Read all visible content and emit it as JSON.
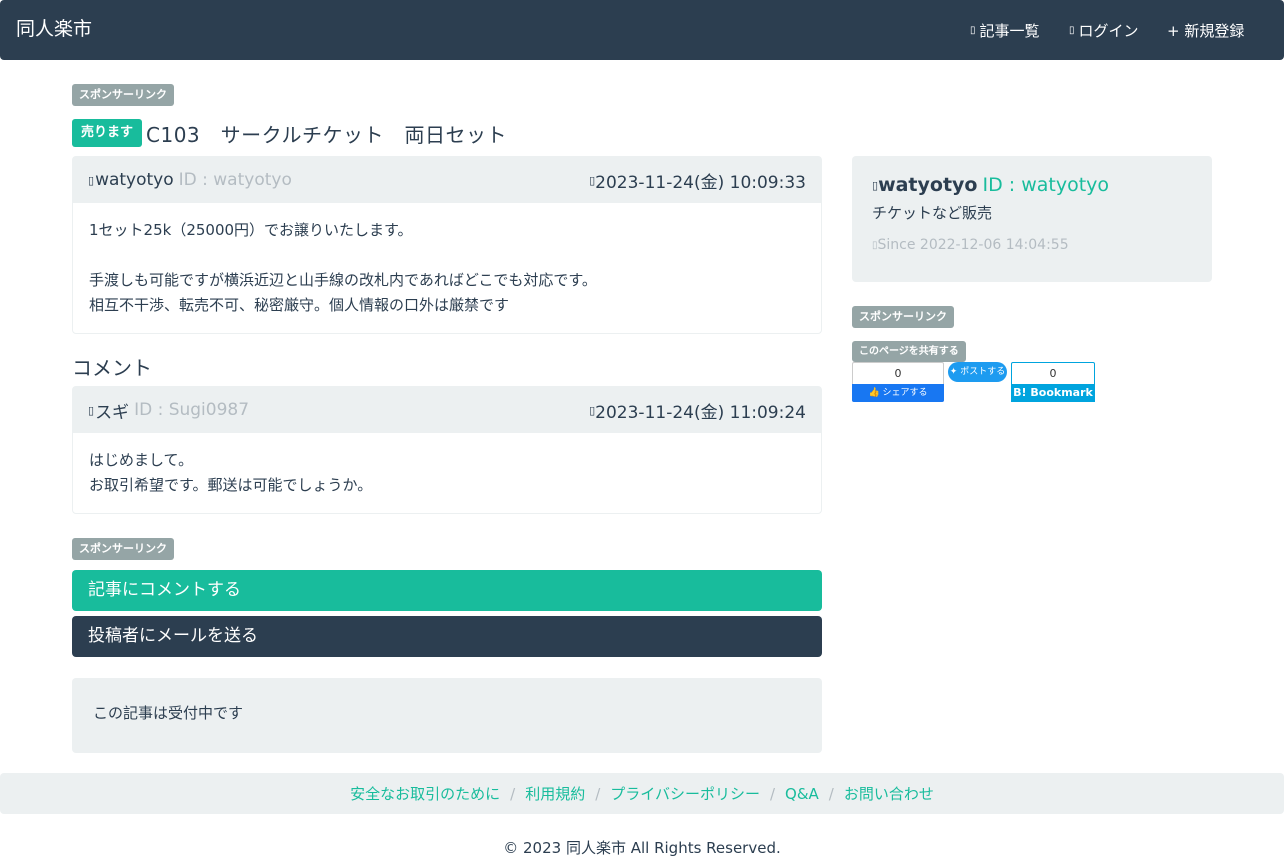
{
  "navbar": {
    "brand": "同人楽市",
    "items": [
      {
        "icon": "list-icon",
        "label": "記事一覧"
      },
      {
        "icon": "login-icon",
        "label": "ログイン"
      },
      {
        "icon": "plus-icon",
        "label": "+ 新規登録"
      }
    ]
  },
  "sponsor_label": "スポンサーリンク",
  "post": {
    "status_badge": "売ります",
    "title": "C103　サークルチケット　両日セット",
    "author": "watyotyo",
    "author_id": "ID : watyotyo",
    "date": "2023-11-24(金) 10:09:33",
    "body_lines": [
      "1セット25k（25000円）でお譲りいたします。",
      "",
      "手渡しも可能ですが横浜近辺と山手線の改札内であればどこでも対応です。",
      "相互不干渉、転売不可、秘密厳守。個人情報の口外は厳禁です"
    ]
  },
  "comments": {
    "heading": "コメント",
    "items": [
      {
        "author": " スギ",
        "author_id": "ID : Sugi0987",
        "date": "2023-11-24(金) 11:09:24",
        "body_lines": [
          "はじめまして。",
          "お取引希望です。郵送は可能でしょうか。"
        ]
      }
    ]
  },
  "actions": {
    "comment_button": "記事にコメントする",
    "mail_button": "投稿者にメールを送る"
  },
  "status_message": "この記事は受付中です",
  "sidebar": {
    "profile": {
      "name": "watyotyo",
      "id": "ID : watyotyo",
      "description": "チケットなど販売",
      "since": "Since 2022-12-06 14:04:55"
    },
    "share_label": "このページを共有する",
    "share": {
      "facebook_count": "0",
      "facebook_label": "シェアする",
      "twitter_label": "ポストする",
      "hatena_count": "0",
      "hatena_label": "B! Bookmark"
    }
  },
  "footer": {
    "links": [
      "安全なお取引のために",
      "利用規約",
      "プライバシーポリシー",
      "Q&A",
      "お問い合わせ"
    ],
    "copyright": "© 2023 同人楽市 All Rights Reserved."
  },
  "colors": {
    "primary": "#2c3e50",
    "accent": "#18bc9c",
    "muted": "#95a5a6",
    "light": "#ecf0f1"
  }
}
